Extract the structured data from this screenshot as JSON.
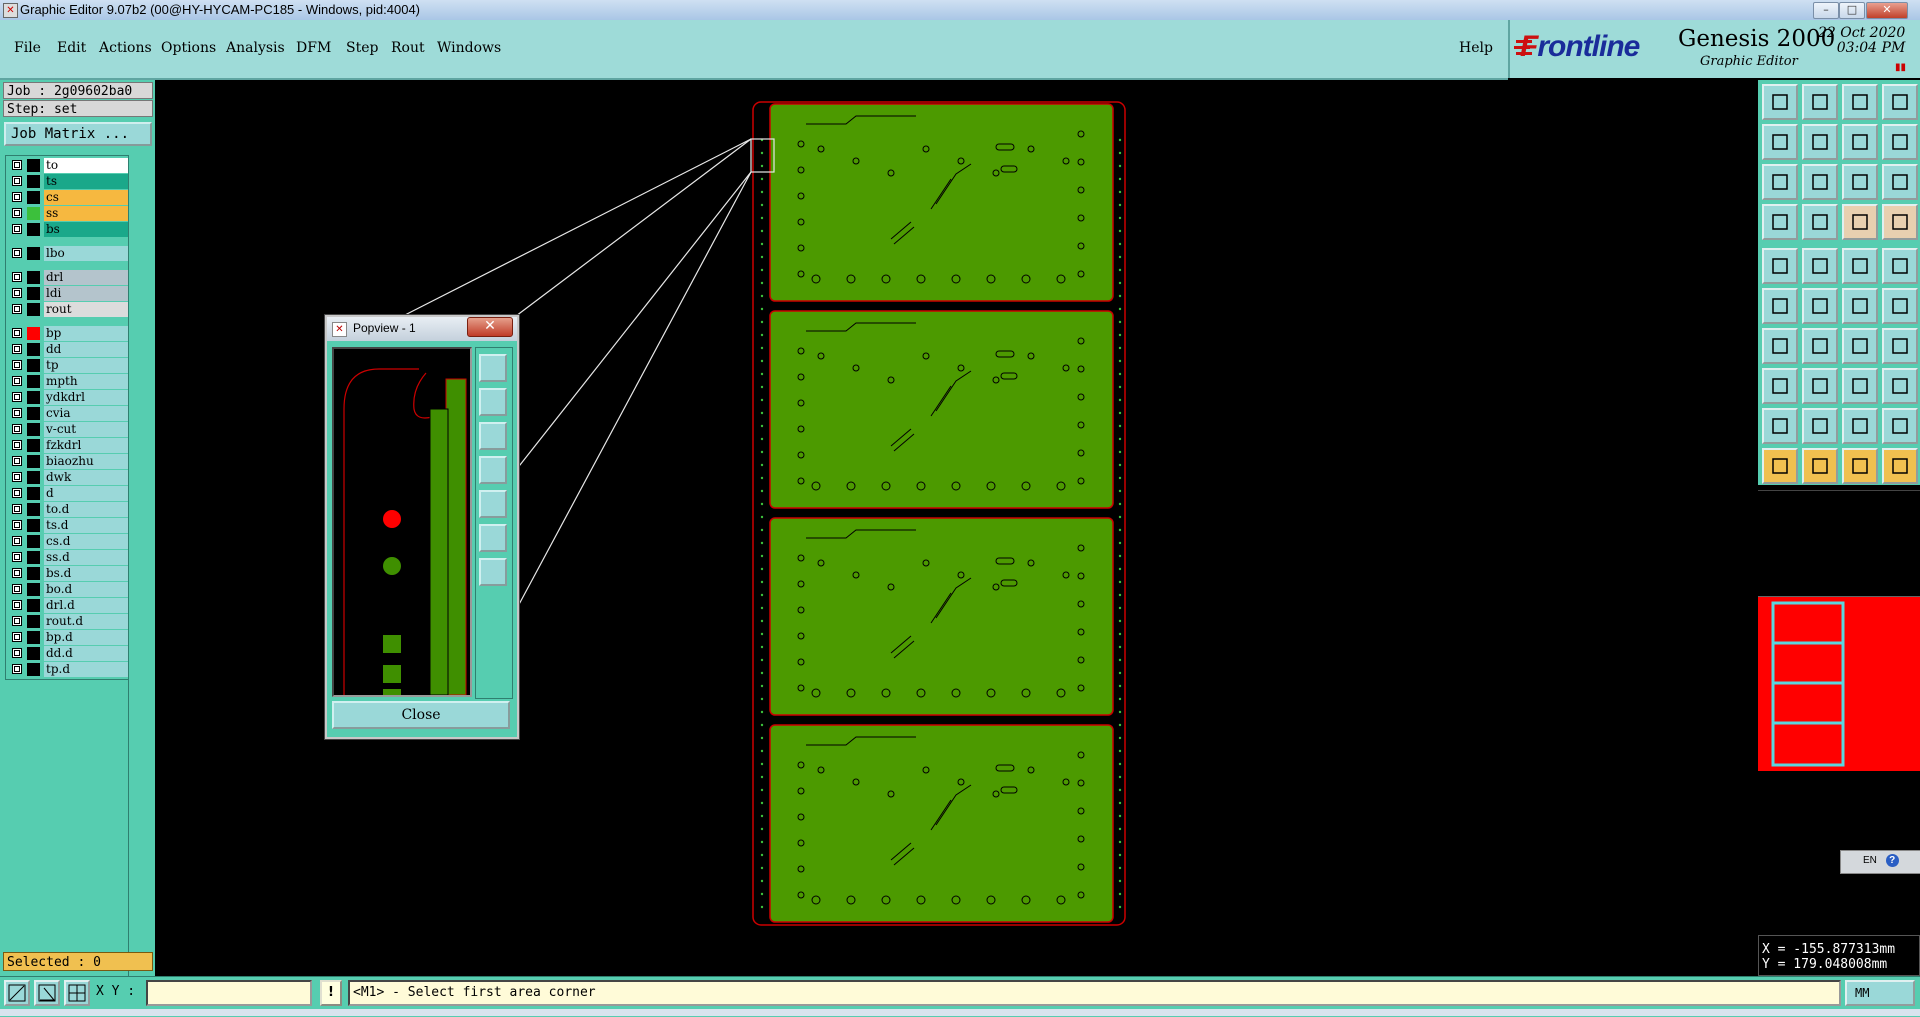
{
  "window": {
    "title": "Graphic Editor 9.07b2 (00@HY-HYCAM-PC185 - Windows, pid:4004)",
    "minimize": "–",
    "maximize": "□",
    "close": "✕"
  },
  "menu": [
    {
      "label": "File"
    },
    {
      "label": "Edit"
    },
    {
      "label": "Actions"
    },
    {
      "label": "Options"
    },
    {
      "label": "Analysis"
    },
    {
      "label": "DFM"
    },
    {
      "label": "Step"
    },
    {
      "label": "Rout"
    },
    {
      "label": "Windows"
    }
  ],
  "help_label": "Help",
  "brand": {
    "logo_f": "F",
    "logo_rest": "rontline",
    "product": "Genesis 2000",
    "subtitle": "Graphic Editor",
    "date": "22 Oct 2020",
    "time": "03:04 PM",
    "pause": "▮▮"
  },
  "job": {
    "job": "Job : 2g09602ba0",
    "step": "Step: set",
    "matrix_button": "Job Matrix ..."
  },
  "layers": [
    {
      "name": "to",
      "color": "#ffffff",
      "swatch": "#000000"
    },
    {
      "name": "ts",
      "color": "#1aa88a",
      "swatch": "#000000"
    },
    {
      "name": "cs",
      "color": "#f6b840",
      "swatch": "#000000"
    },
    {
      "name": "ss",
      "color": "#f6b840",
      "swatch": "#3cc03c"
    },
    {
      "name": "bs",
      "color": "#1aa88a",
      "swatch": "#000000"
    },
    {
      "name": "lbo",
      "color": "#9ad8d8",
      "swatch": "#000000"
    },
    {
      "name": "drl",
      "color": "#b4c4cc",
      "swatch": "#000000"
    },
    {
      "name": "ldi",
      "color": "#b4c4cc",
      "swatch": "#000000"
    },
    {
      "name": "rout",
      "color": "#dcdcdc",
      "swatch": "#000000"
    },
    {
      "name": "bp",
      "color": "#9ad8d8",
      "swatch": "#ff0000"
    },
    {
      "name": "dd",
      "color": "#9ad8d8",
      "swatch": "#000000"
    },
    {
      "name": "tp",
      "color": "#9ad8d8",
      "swatch": "#000000"
    },
    {
      "name": "mpth",
      "color": "#9ad8d8",
      "swatch": "#000000"
    },
    {
      "name": "ydkdrl",
      "color": "#9ad8d8",
      "swatch": "#000000"
    },
    {
      "name": "cvia",
      "color": "#9ad8d8",
      "swatch": "#000000"
    },
    {
      "name": "v-cut",
      "color": "#9ad8d8",
      "swatch": "#000000"
    },
    {
      "name": "fzkdrl",
      "color": "#9ad8d8",
      "swatch": "#000000"
    },
    {
      "name": "biaozhu",
      "color": "#9ad8d8",
      "swatch": "#000000"
    },
    {
      "name": "dwk",
      "color": "#9ad8d8",
      "swatch": "#000000"
    },
    {
      "name": "d",
      "color": "#9ad8d8",
      "swatch": "#000000"
    },
    {
      "name": "to.d",
      "color": "#9ad8d8",
      "swatch": "#000000"
    },
    {
      "name": "ts.d",
      "color": "#9ad8d8",
      "swatch": "#000000"
    },
    {
      "name": "cs.d",
      "color": "#9ad8d8",
      "swatch": "#000000"
    },
    {
      "name": "ss.d",
      "color": "#9ad8d8",
      "swatch": "#000000"
    },
    {
      "name": "bs.d",
      "color": "#9ad8d8",
      "swatch": "#000000"
    },
    {
      "name": "bo.d",
      "color": "#9ad8d8",
      "swatch": "#000000"
    },
    {
      "name": "drl.d",
      "color": "#9ad8d8",
      "swatch": "#000000"
    },
    {
      "name": "rout.d",
      "color": "#9ad8d8",
      "swatch": "#000000"
    },
    {
      "name": "bp.d",
      "color": "#9ad8d8",
      "swatch": "#000000"
    },
    {
      "name": "dd.d",
      "color": "#9ad8d8",
      "swatch": "#000000"
    },
    {
      "name": "tp.d",
      "color": "#9ad8d8",
      "swatch": "#000000"
    }
  ],
  "selected": "Selected : 0",
  "popview": {
    "title": "Popview - 1",
    "close_x": "✕",
    "close_button": "Close"
  },
  "canvas": {
    "board_count": 4,
    "board_color": "#4c9a00",
    "outline_color": "#cc0000"
  },
  "coords": {
    "x": "X = -155.877313mm",
    "y": "Y = 179.048008mm"
  },
  "lang": {
    "text": "EN",
    "help": "?"
  },
  "bottom": {
    "xy_label": "X Y :",
    "xy_value": "",
    "excl": "!",
    "prompt": "<M1> - Select first area corner",
    "units": "MM"
  },
  "right_tools": [
    "open-step-icon",
    "save-icon",
    "home-icon",
    "grid-icon",
    "panel-left-icon",
    "panel-right-icon",
    "snap-icon",
    "route-icon",
    "zoom-fit-icon",
    "zoom-home-icon",
    "scale-1-2-icon",
    "help-query-icon",
    "measure-icon",
    "pin-icon",
    "layer-compare-icon",
    "layer-compare2-icon",
    "camera-icon",
    "color-fill-icon",
    "ruler-icon",
    "pad-icon",
    "node-add-icon",
    "node-cross-icon",
    "line-point-icon",
    "line-blue-icon",
    "line-red-icon",
    "line-angle-icon",
    "arc-icon",
    "distort-icon",
    "connect-icon",
    "line-horizontal-icon",
    "stretch-icon",
    "polygon-icon",
    "triangle-icon",
    "triangle2-icon",
    "arch-icon",
    "arch2-icon",
    "select-pointer-icon",
    "select-pointer2-icon",
    "select-pointer3-icon",
    "select-route-icon"
  ]
}
